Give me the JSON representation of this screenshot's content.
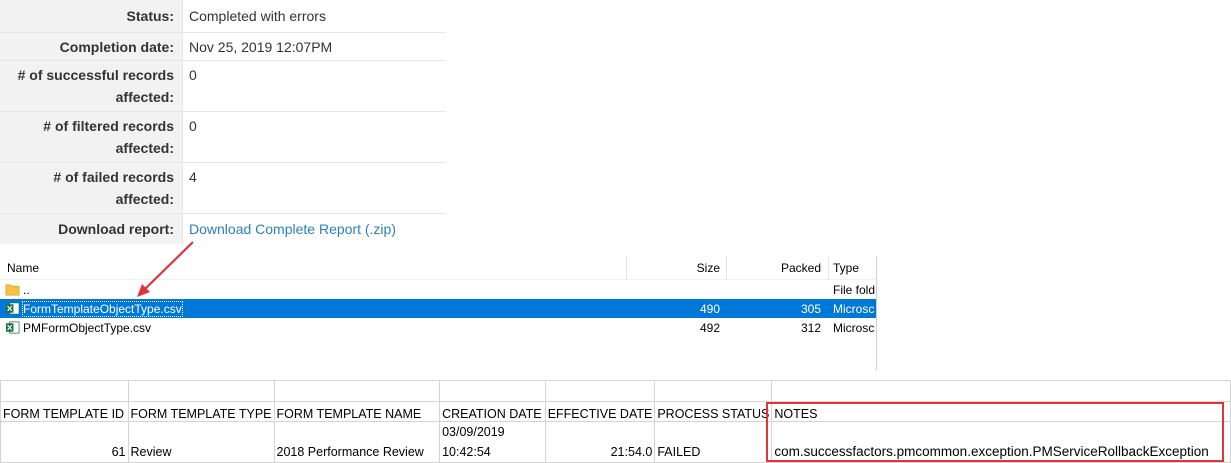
{
  "status_panel": {
    "rows": [
      {
        "label": "Status:",
        "value": "Completed with errors"
      },
      {
        "label": "Completion date:",
        "value": "Nov 25, 2019 12:07PM"
      },
      {
        "label": "# of successful records affected:",
        "value": "0"
      },
      {
        "label": "# of filtered records affected:",
        "value": "0"
      },
      {
        "label": "# of failed records affected:",
        "value": "4"
      },
      {
        "label": "Download report:",
        "value": "Download Complete Report (.zip)"
      }
    ]
  },
  "archive": {
    "columns": {
      "name": "Name",
      "size": "Size",
      "packed": "Packed",
      "type": "Type"
    },
    "files": [
      {
        "name": "..",
        "size": "",
        "packed": "",
        "type": "File fold",
        "icon": "folder-icon"
      },
      {
        "name": "FormTemplateObjectType.csv",
        "size": "490",
        "packed": "305",
        "type": "Microsc",
        "icon": "excel-icon",
        "selected": true
      },
      {
        "name": "PMFormObjectType.csv",
        "size": "492",
        "packed": "312",
        "type": "Microsc",
        "icon": "excel-icon"
      }
    ]
  },
  "sheet": {
    "headers": [
      "FORM TEMPLATE ID",
      "FORM TEMPLATE TYPE",
      "FORM TEMPLATE NAME",
      "CREATION DATE",
      "EFFECTIVE DATE",
      "PROCESS STATUS",
      "NOTES"
    ],
    "row": {
      "id": "61",
      "type": "Review",
      "name": "2018 Performance Review",
      "creation_date": "03/09/2019",
      "creation_time": "10:42:54",
      "effective_date": "21:54.0",
      "status": "FAILED",
      "notes": "com.successfactors.pmcommon.exception.PMServiceRollbackException"
    }
  },
  "colors": {
    "link": "#2a7fbf",
    "selection": "#0078d7",
    "annotation": "#e0333a"
  }
}
